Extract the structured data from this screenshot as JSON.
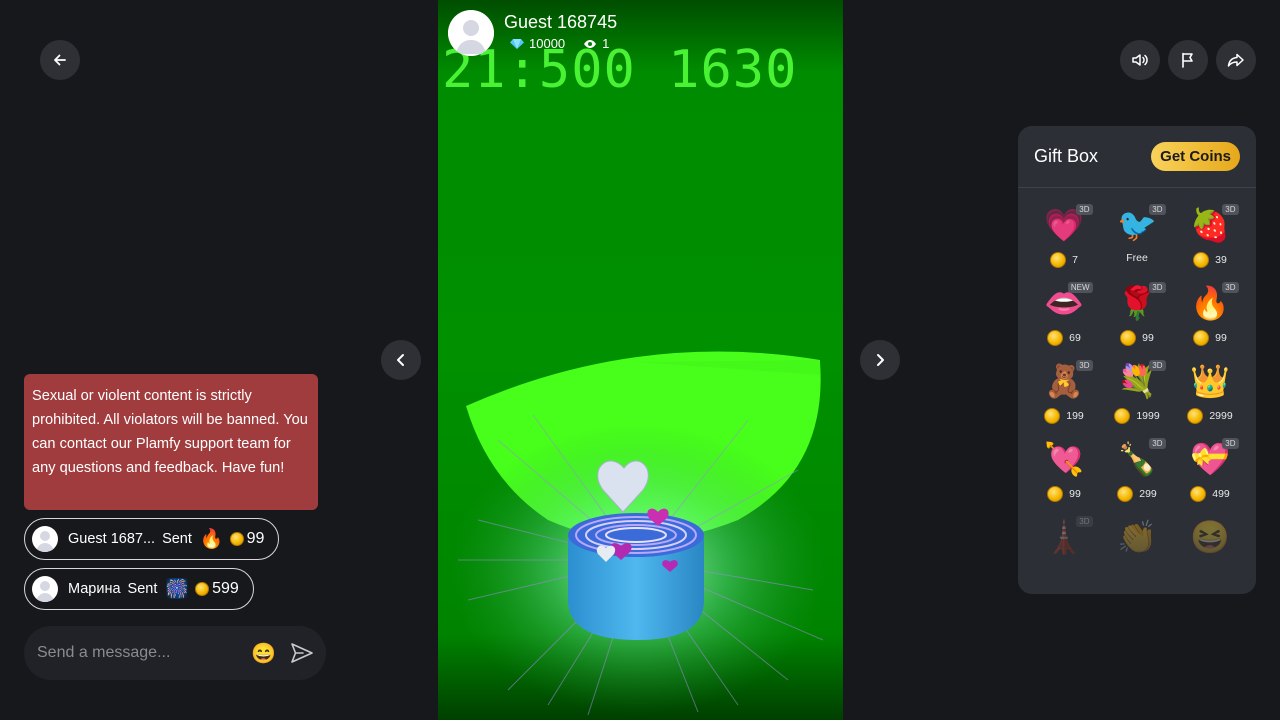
{
  "streamer": {
    "name": "Guest 168745",
    "diamonds": "10000",
    "viewers": "1"
  },
  "video": {
    "overlay_text": "21:500 1630"
  },
  "notice": {
    "text": "Sexual or violent content is strictly prohibited. All violators will be banned. You can contact our Plamfy support team for any questions and feedback. Have fun!"
  },
  "chat": {
    "gift_messages": [
      {
        "user": "Guest 1687...",
        "action": "Sent",
        "gift_icon": "fire",
        "gift_emoji": "🔥",
        "amount": "99"
      },
      {
        "user": "Марина",
        "action": "Sent",
        "gift_icon": "fireworks",
        "gift_emoji": "🎆",
        "amount": "599"
      }
    ],
    "input_placeholder": "Send a message...",
    "emoji_button": "😄"
  },
  "gift_box": {
    "title": "Gift Box",
    "get_coins_label": "Get Coins",
    "gifts": [
      {
        "icon": "follow-me-heart",
        "emoji": "💗",
        "badge": "3D",
        "price": "7"
      },
      {
        "icon": "hi-bird",
        "emoji": "🐦",
        "badge": "3D",
        "price": "Free"
      },
      {
        "icon": "strawberry",
        "emoji": "🍓",
        "badge": "3D",
        "price": "39"
      },
      {
        "icon": "lips",
        "emoji": "👄",
        "badge": "NEW",
        "price": "69"
      },
      {
        "icon": "rose",
        "emoji": "🌹",
        "badge": "3D",
        "price": "99"
      },
      {
        "icon": "fire",
        "emoji": "🔥",
        "badge": "3D",
        "price": "99"
      },
      {
        "icon": "teddy-bear",
        "emoji": "🧸",
        "badge": "3D",
        "price": "199"
      },
      {
        "icon": "rose-bouquet",
        "emoji": "💐",
        "badge": "3D",
        "price": "1999"
      },
      {
        "icon": "tiara",
        "emoji": "👑",
        "badge": "",
        "price": "2999"
      },
      {
        "icon": "heart-arrow",
        "emoji": "💘",
        "badge": "",
        "price": "99"
      },
      {
        "icon": "champagne",
        "emoji": "🍾",
        "badge": "3D",
        "price": "299"
      },
      {
        "icon": "heart-gift-box",
        "emoji": "💝",
        "badge": "3D",
        "price": "499"
      },
      {
        "icon": "eiffel-tower",
        "emoji": "🗼",
        "badge": "3D",
        "price": ""
      },
      {
        "icon": "clapping-hands",
        "emoji": "👏",
        "badge": "",
        "price": ""
      },
      {
        "icon": "laughing-face",
        "emoji": "😆",
        "badge": "",
        "price": ""
      }
    ]
  },
  "colors": {
    "background": "#17181c",
    "notice_bg": "#a13c3e",
    "accent_coin": "#f5b800",
    "video_green": "#009000"
  }
}
